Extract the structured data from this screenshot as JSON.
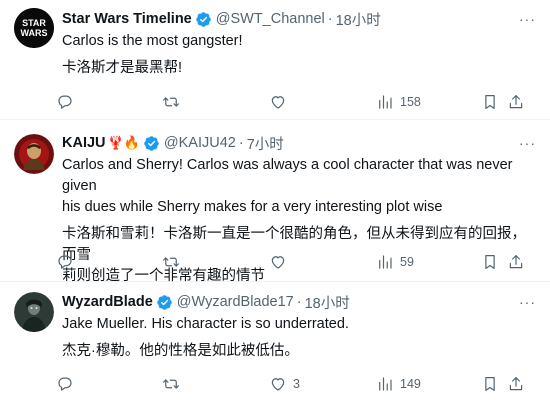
{
  "colors": {
    "verified": "#1d9bf0",
    "secondary_text": "#536471",
    "divider": "#eff3f4"
  },
  "tweets": [
    {
      "name": "Star Wars Timeline",
      "handle": "@SWT_Channel",
      "time": "18小时",
      "avatar_text": "STAR WARS",
      "more": "···",
      "text_lines": [
        "Carlos is the most gangster!",
        "卡洛斯才是最黑帮!"
      ],
      "actions": {
        "reply": "",
        "retweet": "",
        "like": "",
        "views": "158"
      }
    },
    {
      "name": "KAIJU",
      "handle": "@KAIJU42",
      "time": "7小时",
      "emojis": "🦞🔥",
      "more": "···",
      "text_lines": [
        "Carlos and Sherry! Carlos was always a cool character that was never given",
        "his dues while Sherry makes for a very interesting plot wise",
        "卡洛斯和雪莉！卡洛斯一直是一个很酷的角色，但从未得到应有的回报，而雪",
        "莉则创造了一个非常有趣的情节"
      ],
      "actions": {
        "reply": "",
        "retweet": "",
        "like": "",
        "views": "59"
      }
    },
    {
      "name": "WyzardBlade",
      "handle": "@WyzardBlade17",
      "time": "18小时",
      "more": "···",
      "text_lines": [
        "Jake Mueller.  His character is so underrated.",
        "杰克·穆勒。他的性格是如此被低估。"
      ],
      "actions": {
        "reply": "",
        "retweet": "",
        "like": "3",
        "views": "149"
      }
    }
  ]
}
